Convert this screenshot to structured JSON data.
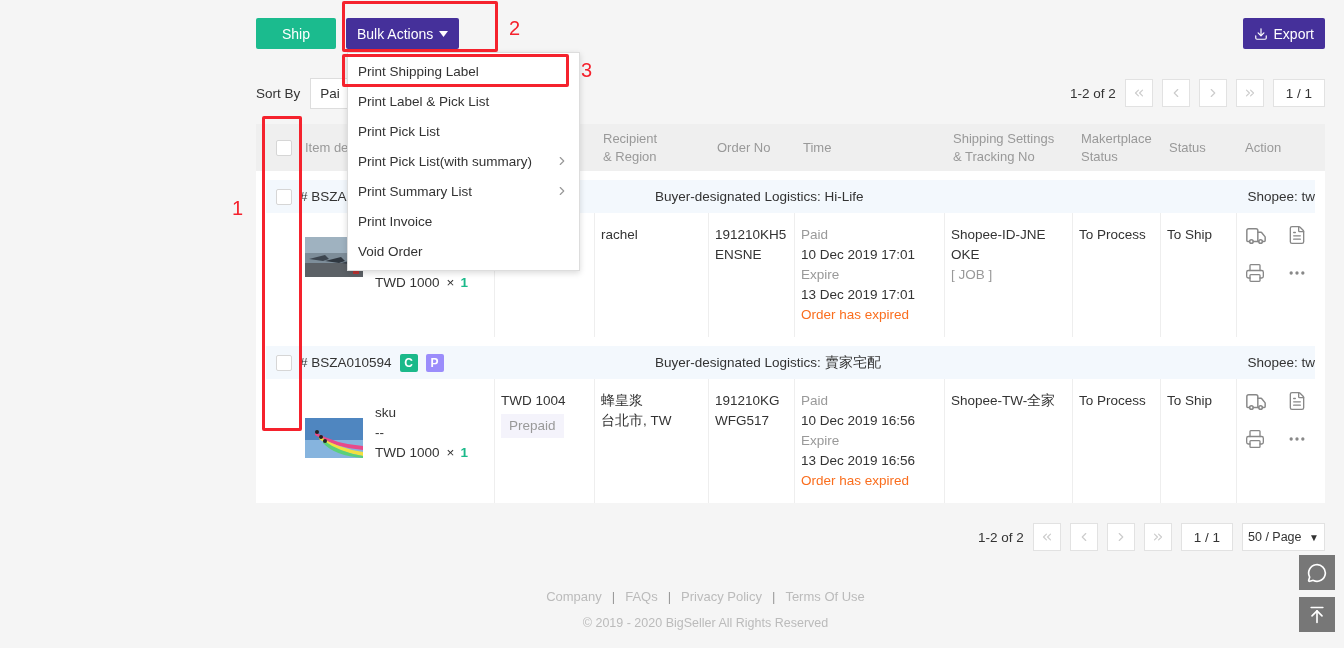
{
  "toolbar": {
    "ship": "Ship",
    "bulk": "Bulk Actions",
    "export": "Export"
  },
  "bulk_menu": {
    "open": true,
    "items": [
      {
        "label": "Print Shipping Label",
        "submenu": false
      },
      {
        "label": "Print Label & Pick List",
        "submenu": false
      },
      {
        "label": "Print Pick List",
        "submenu": false
      },
      {
        "label": "Print Pick List(with summary)",
        "submenu": true
      },
      {
        "label": "Print Summary List",
        "submenu": true
      },
      {
        "label": "Print Invoice",
        "submenu": false
      },
      {
        "label": "Void Order",
        "submenu": false
      }
    ]
  },
  "sort": {
    "label": "Sort By",
    "value": "Pai"
  },
  "pager_top": {
    "range": "1-2 of 2",
    "page": "1 / 1"
  },
  "table": {
    "select_all": {
      "checked": false
    },
    "columns": [
      {
        "lines": [
          "Item de"
        ]
      },
      {},
      {
        "lines": [
          "Recipient",
          "& Region"
        ]
      },
      {
        "lines": [
          "Order No"
        ]
      },
      {
        "lines": [
          "Time"
        ]
      },
      {
        "lines": [
          "Shipping Settings",
          "& Tracking No"
        ]
      },
      {
        "lines": [
          "Makertplace",
          "Status"
        ]
      },
      {
        "lines": [
          "Status"
        ]
      },
      {
        "lines": [
          "Action"
        ]
      }
    ],
    "orders": [
      {
        "checked": false,
        "order_no": "# BSZA",
        "logistics": "Buyer-designated Logistics: Hi-Life",
        "store": "Shopee: tw",
        "item": {
          "price": "TWD 1000",
          "times": "×",
          "qty": "1"
        },
        "recipient": [
          "rachel"
        ],
        "order_id": [
          "191210KH5",
          "ENSNE"
        ],
        "time": [
          {
            "kind": "label",
            "text": "Paid"
          },
          {
            "kind": "value",
            "text": "10 Dec 2019 17:01"
          },
          {
            "kind": "label",
            "text": "Expire"
          },
          {
            "kind": "value",
            "text": "13 Dec 2019 17:01"
          },
          {
            "kind": "alert",
            "text": "Order has expired"
          }
        ],
        "shipping": [
          "Shopee-ID-JNE",
          "OKE"
        ],
        "tracking": "[ JOB ]",
        "marketplace_status": "To Process",
        "status": "To Ship"
      },
      {
        "checked": false,
        "order_no": "# BSZA010594",
        "badges": [
          {
            "label": "C",
            "color": "#1bb98a"
          },
          {
            "label": "P",
            "color": "#9b8dfb"
          }
        ],
        "logistics": "Buyer-designated Logistics: 賣家宅配",
        "store": "Shopee: tw",
        "item": {
          "lines": [
            "sku",
            "--"
          ],
          "price": "TWD 1000",
          "times": "×",
          "qty": "1"
        },
        "amount": {
          "total": "TWD 1004",
          "payment": "Prepaid"
        },
        "recipient": [
          "蜂皇浆",
          "台北市, TW"
        ],
        "order_id": [
          "191210KG",
          "WFG517"
        ],
        "time": [
          {
            "kind": "label",
            "text": "Paid"
          },
          {
            "kind": "value",
            "text": "10 Dec 2019 16:56"
          },
          {
            "kind": "label",
            "text": "Expire"
          },
          {
            "kind": "value",
            "text": "13 Dec 2019 16:56"
          },
          {
            "kind": "alert",
            "text": "Order has expired"
          }
        ],
        "shipping": [
          "Shopee-TW-全家"
        ],
        "marketplace_status": "To Process",
        "status": "To Ship"
      }
    ]
  },
  "pager_bottom": {
    "range": "1-2 of 2",
    "page": "1 / 1",
    "page_size": "50 / Page",
    "caret": "▼"
  },
  "footer": {
    "links": [
      "Company",
      "FAQs",
      "Privacy Policy",
      "Terms Of Use"
    ],
    "separator": "|",
    "copyright": "© 2019 - 2020 BigSeller All Rights Reserved"
  },
  "annotations": [
    {
      "label": "1"
    },
    {
      "label": "2"
    },
    {
      "label": "3"
    }
  ]
}
